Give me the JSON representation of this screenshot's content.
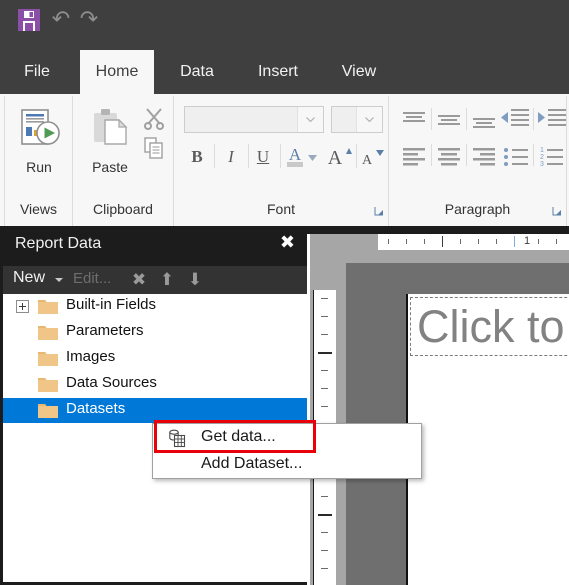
{
  "quick_access": {
    "save_label": "Save",
    "save_icon": "floppy-disk-icon",
    "save_color": "#8c4fa8",
    "undo_label": "Undo",
    "undo_glyph": "↶",
    "redo_label": "Redo",
    "redo_glyph": "↷"
  },
  "ribbon": {
    "tabs": [
      {
        "label": "File",
        "active": false
      },
      {
        "label": "Home",
        "active": true
      },
      {
        "label": "Data",
        "active": false
      },
      {
        "label": "Insert",
        "active": false
      },
      {
        "label": "View",
        "active": false
      }
    ],
    "groups": [
      {
        "label": "Views",
        "has_launcher": false
      },
      {
        "label": "Clipboard",
        "has_launcher": false
      },
      {
        "label": "Font",
        "has_launcher": true
      },
      {
        "label": "Paragraph",
        "has_launcher": true
      }
    ],
    "views": {
      "run_label": "Run",
      "run_icon": "run-report-icon"
    },
    "clipboard": {
      "paste_label": "Paste",
      "paste_icon": "clipboard-paste-icon",
      "cut_icon": "scissors-icon",
      "copy_icon": "copy-icon"
    },
    "font": {
      "font_name_value": "",
      "font_name_placeholder": "",
      "font_size_value": "",
      "font_size_placeholder": "",
      "bold_label": "B",
      "italic_label": "I",
      "underline_label": "U",
      "font_color_label": "A",
      "grow_font_label": "A",
      "shrink_font_label": "A"
    },
    "paragraph": {
      "align_top_icon": "align-top-icon",
      "align_middle_icon": "align-middle-icon",
      "align_bottom_icon": "align-bottom-icon",
      "decrease_indent_icon": "decrease-indent-icon",
      "increase_indent_icon": "increase-indent-icon",
      "align_left_icon": "align-left-icon",
      "align_center_icon": "align-center-icon",
      "align_right_icon": "align-right-icon",
      "bullets_icon": "bullet-list-icon",
      "numbering_icon": "numbered-list-icon"
    }
  },
  "report_data": {
    "title": "Report Data",
    "close_glyph": "✖",
    "toolbar": {
      "new_label": "New",
      "new_caret": "chevron-down-icon",
      "edit_label": "Edit...",
      "delete_icon": "delete-x-icon",
      "delete_glyph": "✖",
      "move_up_icon": "arrow-up-icon",
      "move_up_glyph": "⬆",
      "move_down_icon": "arrow-down-icon",
      "move_down_glyph": "⬇"
    },
    "selection_color": "#0078d7",
    "tree": [
      {
        "label": "Built-in Fields",
        "expandable": true,
        "selected": false
      },
      {
        "label": "Parameters",
        "expandable": false,
        "selected": false
      },
      {
        "label": "Images",
        "expandable": false,
        "selected": false
      },
      {
        "label": "Data Sources",
        "expandable": false,
        "selected": false
      },
      {
        "label": "Datasets",
        "expandable": false,
        "selected": true
      }
    ]
  },
  "context_menu": {
    "items": [
      {
        "label": "Get data...",
        "icon": "get-data-icon",
        "highlighted": true
      },
      {
        "label": "Add Dataset...",
        "icon": "",
        "highlighted": false
      }
    ],
    "highlight_color": "#e8000b"
  },
  "design_surface": {
    "ruler_number": "1",
    "placeholder_text": "Click to",
    "page_background": "#ffffff",
    "canvas_background": "#6f6f6f",
    "workspace_background": "#a6a6a6"
  }
}
